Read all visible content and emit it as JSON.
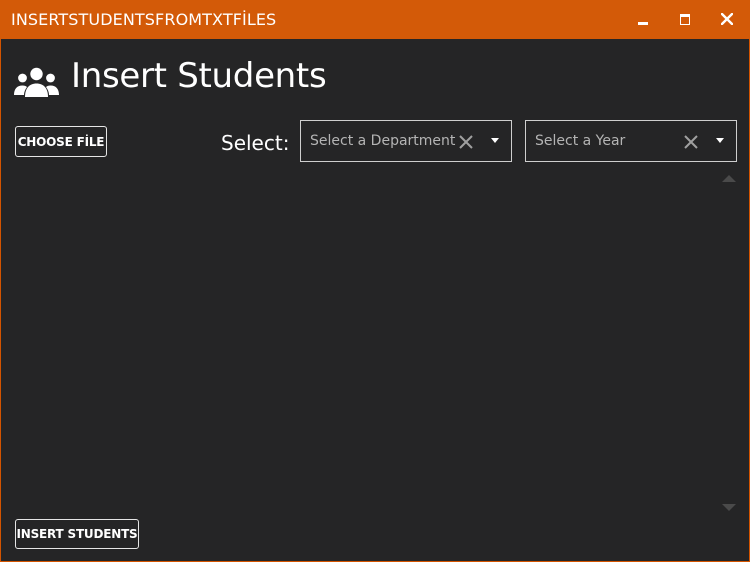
{
  "window": {
    "title": "INSERTSTUDENTSFROMTXTFİLES",
    "accent_color": "#d35a08",
    "background_color": "#252526",
    "controls": [
      "minimize-icon",
      "maximize-icon",
      "close-icon"
    ]
  },
  "header": {
    "icon": "users-icon",
    "title": "Insert Students"
  },
  "toolbar": {
    "choose_file_label": "CHOOSE FİLE",
    "select_label": "Select:"
  },
  "department_select": {
    "placeholder": "Select a Department",
    "value": "",
    "clear_icon": "clear-x-icon",
    "dropdown_icon": "caret-down-icon"
  },
  "year_select": {
    "placeholder": "Select a Year",
    "value": "",
    "clear_icon": "clear-x-icon",
    "dropdown_icon": "caret-down-icon"
  },
  "student_list": {
    "items": []
  },
  "footer": {
    "insert_label": "INSERT STUDENTS"
  }
}
